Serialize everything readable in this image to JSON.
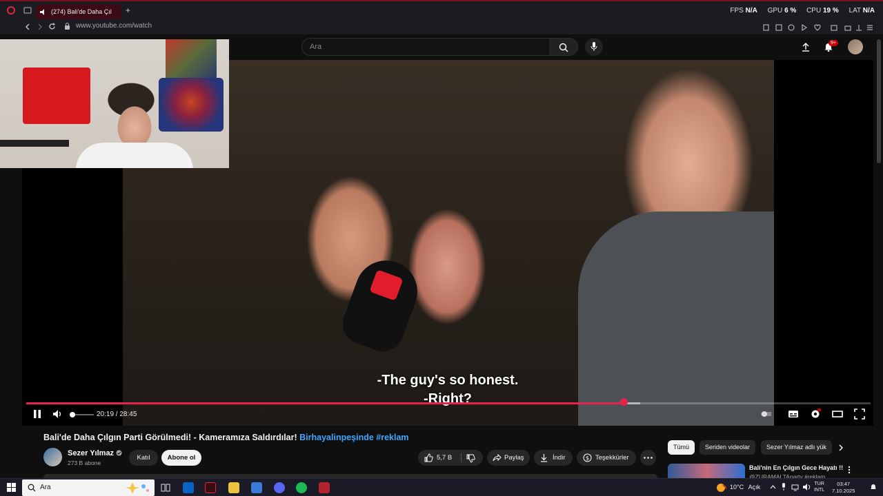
{
  "browser": {
    "tab_title": "(274) Bali'de Daha Çıl",
    "url": "www.youtube.com/watch",
    "stats": [
      {
        "label": "FPS",
        "value": "N/A"
      },
      {
        "label": "GPU",
        "value": "6 %"
      },
      {
        "label": "CPU",
        "value": "19 %"
      },
      {
        "label": "LAT",
        "value": "N/A"
      }
    ]
  },
  "masthead": {
    "search_placeholder": "Ara",
    "notification_count": "9+"
  },
  "player": {
    "subtitle_line1": "-The guy's so honest.",
    "subtitle_line2": "-Right?",
    "time": "20:19 / 28:45",
    "progress": 0.708,
    "buffered": 0.727,
    "volume": 0.1
  },
  "video": {
    "title": "Bali'de Daha Çılgın Parti Görülmedi! - Kameramıza Saldırdılar!",
    "hashtags": "Birhayalinpeşinde #reklam",
    "channel": "Sezer Yılmaz",
    "subscribers": "273 B abone",
    "join_label": "Katıl",
    "subscribe_label": "Abone ol",
    "likes": "5,7 B",
    "share_label": "Paylaş",
    "download_label": "İndir",
    "thanks_label": "Teşekkürler"
  },
  "chips": [
    "Tümü",
    "Seriden videolar",
    "Sezer Yılmaz adlı yük"
  ],
  "recommended": {
    "title": "Bali'nin En Çılgın Gece Hayatı !!",
    "subtitle": "@ZURAMALTAparty #reklam"
  },
  "taskbar": {
    "search_placeholder": "Ara",
    "temperature": "10°C",
    "weather": "Açık",
    "lang1": "TUR",
    "lang2": "INTL",
    "time": "03:47",
    "date": "7.10.2025"
  },
  "colors": {
    "accent": "#e6234a",
    "link": "#3ea6ff",
    "background": "#0f0f0f"
  }
}
